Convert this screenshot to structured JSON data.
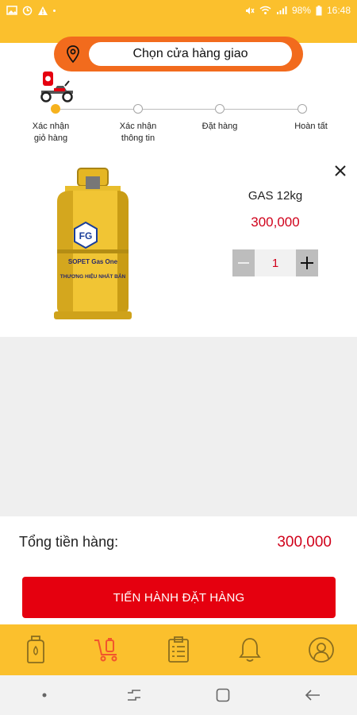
{
  "status_bar": {
    "battery": "98%",
    "time": "16:48"
  },
  "header": {
    "store_select_label": "Chọn cửa hàng giao",
    "steps": [
      {
        "label": "Xác nhận\ngiỏ hàng"
      },
      {
        "label": "Xác nhận\nthông tin"
      },
      {
        "label": "Đặt hàng"
      },
      {
        "label": "Hoàn tất"
      }
    ]
  },
  "cart": {
    "items": [
      {
        "name": "GAS 12kg",
        "price": "300,000",
        "quantity": "1",
        "cylinder_text": [
          "SOPET Gas One",
          "THƯƠNG HIỆU NHẤT BẢN"
        ]
      }
    ]
  },
  "footer": {
    "total_label": "Tổng tiền hàng:",
    "total_value": "300,000",
    "order_button": "TIẾN HÀNH ĐẶT HÀNG"
  },
  "tabs": [
    {
      "icon": "gas-cylinder-icon"
    },
    {
      "icon": "cart-icon"
    },
    {
      "icon": "clipboard-icon"
    },
    {
      "icon": "bell-icon"
    },
    {
      "icon": "user-icon"
    }
  ],
  "colors": {
    "accent": "#fbc02d",
    "orange": "#f26b1d",
    "price": "#d0021b",
    "button": "#e5000f",
    "tab_active": "#f2552c",
    "tab_inactive": "#8a6d1f"
  }
}
